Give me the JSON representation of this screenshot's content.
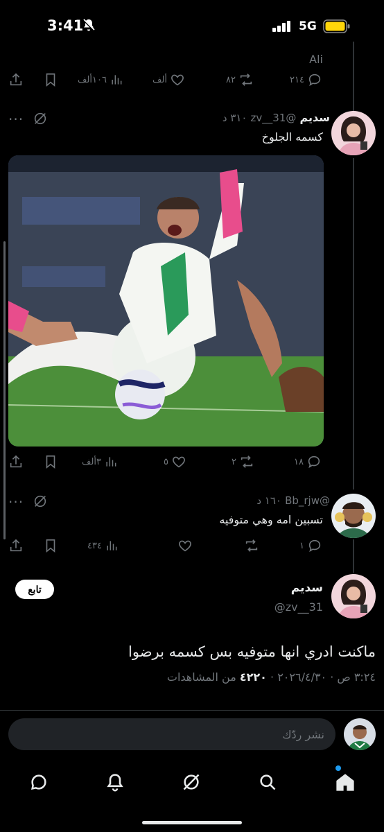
{
  "status_bar": {
    "time": "3:41",
    "network": "5G"
  },
  "prev_tweet": {
    "name_tail": "Ali",
    "actions": {
      "reply": "٢١٤",
      "retweet": "٨٢",
      "like": "ألف",
      "views": "١٠٦ألف"
    }
  },
  "tweet1": {
    "name": "سديم",
    "handle": "@zv__31",
    "time": "٣١٠ د",
    "text": "كسمه الجلوخ",
    "actions": {
      "reply": "١٨",
      "retweet": "٢",
      "like": "٥",
      "views": "٣ألف"
    }
  },
  "tweet2": {
    "handle": "@Bb_rjw",
    "time": "١٦٠ د",
    "text": "تسبين امه وهي متوفيه",
    "actions": {
      "reply": "١",
      "retweet": "",
      "like": "",
      "views": "٤٣٤"
    }
  },
  "main_tweet": {
    "name": "سديم",
    "handle": "@zv__31",
    "follow_label": "تابع",
    "text": "ماكنت ادري انها متوفيه بس كسمه برضوا",
    "datetime": "٣:٢٤ ص · ٢٠٢٦/٤/٣٠",
    "views_count": "٤٢٢٠",
    "views_label": "من المشاهدات"
  },
  "reply": {
    "placeholder": "نشر ردّك"
  },
  "colors": {
    "background": "#000000",
    "text": "#e7e9ea",
    "muted": "#71767b",
    "accent": "#1d9bf0"
  },
  "nav": [
    "home-icon",
    "search-icon",
    "grok-icon",
    "notifications-icon",
    "messages-icon"
  ]
}
